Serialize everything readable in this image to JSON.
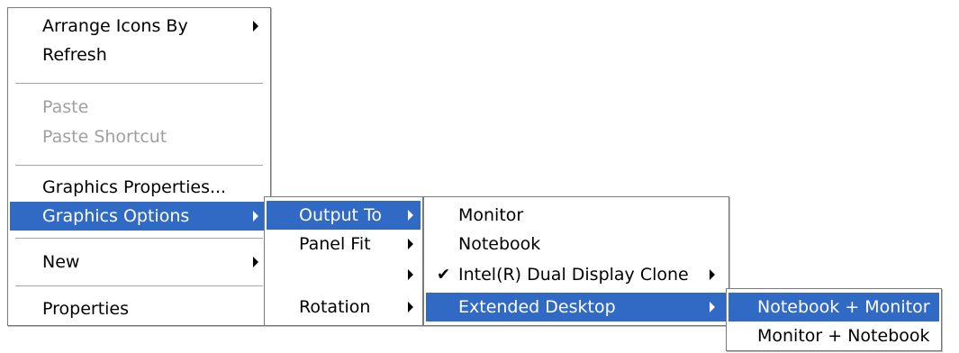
{
  "menu1": {
    "arrange_icons_by": "Arrange Icons By",
    "refresh": "Refresh",
    "paste": "Paste",
    "paste_shortcut": "Paste Shortcut",
    "graphics_properties": "Graphics Properties...",
    "graphics_options": "Graphics Options",
    "new": "New",
    "properties": "Properties"
  },
  "menu2": {
    "output_to": "Output To",
    "panel_fit": "Panel Fit",
    "blank": "",
    "rotation": "Rotation"
  },
  "menu3": {
    "monitor": "Monitor",
    "notebook": "Notebook",
    "dual_display_clone": "Intel(R) Dual Display Clone",
    "dual_display_clone_checked": true,
    "extended_desktop": "Extended Desktop"
  },
  "menu4": {
    "notebook_monitor": "Notebook + Monitor",
    "monitor_notebook": "Monitor + Notebook"
  },
  "colors": {
    "highlight": "#316ac5",
    "disabled_text": "#a0a0a0"
  }
}
